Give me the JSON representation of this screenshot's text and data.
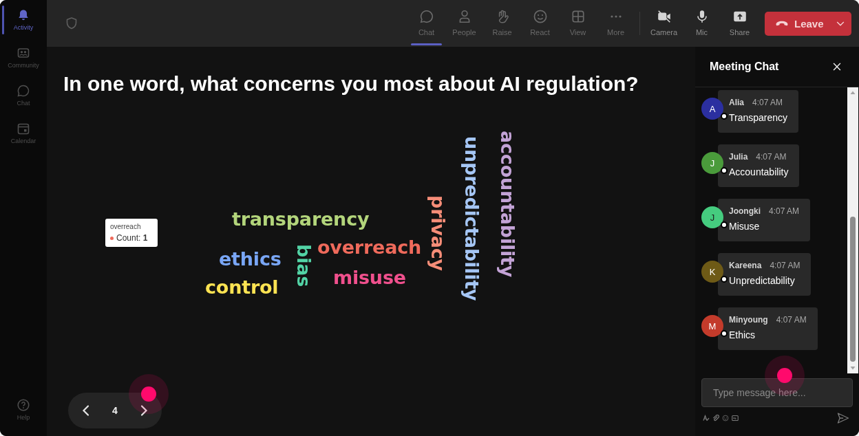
{
  "sidebar": {
    "items": [
      {
        "label": "Activity",
        "selected": true
      },
      {
        "label": "Community",
        "selected": false
      },
      {
        "label": "Chat",
        "selected": false
      },
      {
        "label": "Calendar",
        "selected": false
      }
    ],
    "help": {
      "label": "Help"
    }
  },
  "toolbar": {
    "items": [
      {
        "label": "Chat",
        "selected": true
      },
      {
        "label": "People",
        "selected": false
      },
      {
        "label": "Raise",
        "selected": false
      },
      {
        "label": "React",
        "selected": false
      },
      {
        "label": "View",
        "selected": false
      },
      {
        "label": "More",
        "selected": false
      }
    ],
    "devices": [
      {
        "label": "Camera",
        "on": false
      },
      {
        "label": "Mic",
        "on": true
      }
    ],
    "share": {
      "label": "Share"
    },
    "leave": {
      "label": "Leave"
    }
  },
  "presentation": {
    "question": "In one word, what concerns you most about AI regulation?",
    "word_cloud": {
      "words": [
        {
          "text": "transparency",
          "color": "#b3d57b",
          "kind": "horizontal"
        },
        {
          "text": "ethics",
          "color": "#79a6f6",
          "kind": "horizontal"
        },
        {
          "text": "control",
          "color": "#fde352",
          "kind": "horizontal"
        },
        {
          "text": "bias",
          "color": "#52d3a5",
          "kind": "vertical"
        },
        {
          "text": "overreach",
          "color": "#ef6a5b",
          "kind": "horizontal"
        },
        {
          "text": "misuse",
          "color": "#f0508d",
          "kind": "horizontal"
        },
        {
          "text": "privacy",
          "color": "#f68d78",
          "kind": "vertical"
        },
        {
          "text": "unpredictability",
          "color": "#a5c6f5",
          "kind": "vertical"
        },
        {
          "text": "accountability",
          "color": "#c3a3d6",
          "kind": "vertical"
        }
      ],
      "tooltip": {
        "title": "overreach",
        "value": "Count: **1**",
        "color": "#ef6a5b"
      }
    },
    "pager": {
      "page": "4"
    }
  },
  "chat": {
    "title": "Meeting Chat",
    "messages": [
      {
        "initial": "A",
        "name": "Alia",
        "time": "4:07 AM",
        "text": "Transparency",
        "color": "#2b2fa0"
      },
      {
        "initial": "J",
        "name": "Julia",
        "time": "4:07 AM",
        "text": "Accountability",
        "color": "#4a9b3b"
      },
      {
        "initial": "J",
        "name": "Joongki",
        "time": "4:07 AM",
        "text": "Misuse",
        "color": "#45cc7f"
      },
      {
        "initial": "K",
        "name": "Kareena",
        "time": "4:07 AM",
        "text": "Unpredictability",
        "color": "#6e5a16"
      },
      {
        "initial": "M",
        "name": "Minyoung",
        "time": "4:07 AM",
        "text": "Ethics",
        "color": "#c33b2b"
      }
    ],
    "composer": {
      "placeholder": "Type message here..."
    }
  }
}
